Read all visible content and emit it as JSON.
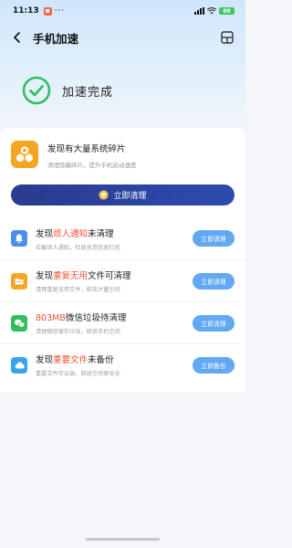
{
  "status_bar": {
    "time": "11:13",
    "dots": "···",
    "battery": "88"
  },
  "header": {
    "title": "手机加速"
  },
  "result": {
    "text": "加速完成"
  },
  "found": {
    "title": "发现有大量系统碎片",
    "subtitle": "清理隐藏碎片，提升手机启动速度"
  },
  "clean_button": {
    "label": "立即清理"
  },
  "tasks": [
    {
      "icon": "bell-icon",
      "icon_color": "#4a8ff0",
      "title_pre": "发现",
      "title_highlight": "烦人通知",
      "title_post": "未清理",
      "subtitle": "拦截烦人通知，杜绝无用信息打扰",
      "button": "立即清理"
    },
    {
      "icon": "folder-icon",
      "icon_color": "#f6a623",
      "title_pre": "发现",
      "title_highlight": "重复无用",
      "title_post": "文件可清理",
      "subtitle": "清理重复无用文件，释放大量空间",
      "button": "立即清理"
    },
    {
      "icon": "wechat-icon",
      "icon_color": "#2fbf5c",
      "title_pre": "",
      "title_highlight": "803MB",
      "title_post": "微信垃圾待清理",
      "subtitle": "清理微信缓存垃圾，释放手机空间",
      "button": "立即清理"
    },
    {
      "icon": "cloud-icon",
      "icon_color": "#3ba2ee",
      "title_pre": "发现",
      "title_highlight": "重要文件",
      "title_post": "未备份",
      "subtitle": "重要文件存云端，释放空间更安全",
      "button": "立即备份"
    }
  ],
  "colors": {
    "accent_dark": "#2a3b8e",
    "highlight": "#f04f2f",
    "check_green": "#2fbf6a",
    "task_button": "#62a8f2"
  }
}
